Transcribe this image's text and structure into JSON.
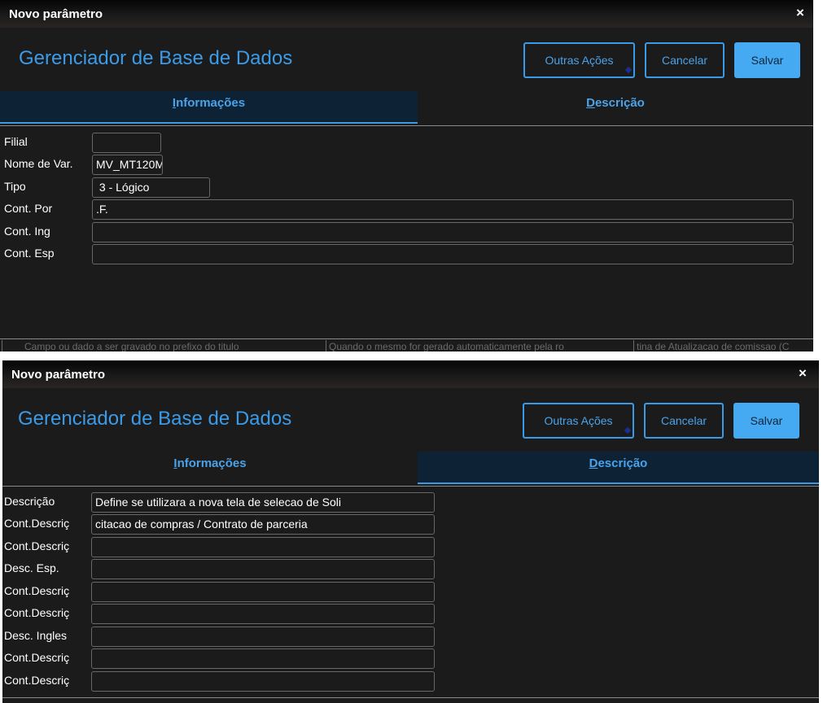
{
  "dialog_title": "Novo parâmetro",
  "close_glyph": "×",
  "app_title": "Gerenciador de Base de Dados",
  "buttons": {
    "other": "Outras Ações",
    "cancel": "Cancelar",
    "save": "Salvar"
  },
  "tabs": {
    "info": "Informações",
    "desc": "Descrição"
  },
  "info_fields": {
    "filial": {
      "label": "Filial",
      "value": ""
    },
    "nome_var": {
      "label": "Nome de Var.",
      "value": "MV_MT120M"
    },
    "tipo": {
      "label": "Tipo",
      "value": " 3 - Lógico"
    },
    "cont_por": {
      "label": "Cont. Por",
      "value": ".F."
    },
    "cont_ing": {
      "label": "Cont. Ing",
      "value": ""
    },
    "cont_esp": {
      "label": "Cont. Esp",
      "value": ""
    }
  },
  "desc_fields": [
    {
      "label": "Descrição",
      "value": "Define se utilizara a nova tela de selecao de Soli"
    },
    {
      "label": "Cont.Descriç",
      "value": "citacao de compras / Contrato de parceria"
    },
    {
      "label": "Cont.Descriç",
      "value": ""
    },
    {
      "label": "Desc. Esp.",
      "value": ""
    },
    {
      "label": "Cont.Descriç",
      "value": ""
    },
    {
      "label": "Cont.Descriç",
      "value": ""
    },
    {
      "label": "Desc. Ingles",
      "value": ""
    },
    {
      "label": "Cont.Descriç",
      "value": ""
    },
    {
      "label": "Cont.Descriç",
      "value": ""
    }
  ],
  "background_row": {
    "col1": "Campo ou dado a ser gravado no prefixo do titulo",
    "col2": "Quando o mesmo for gerado automaticamente pela ro",
    "col3": "tina de Atualizacao de comissao (C"
  }
}
